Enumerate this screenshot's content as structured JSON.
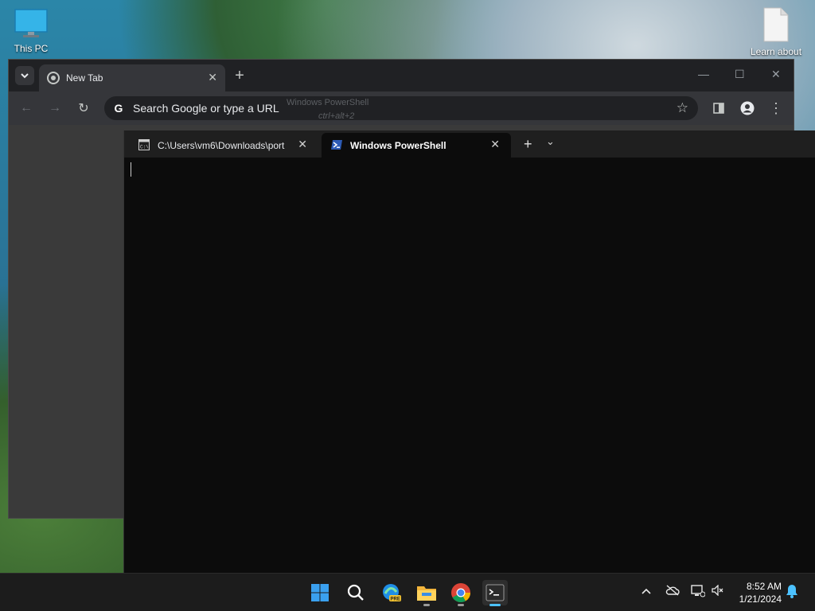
{
  "desktop": {
    "icons": [
      {
        "label": "This PC"
      },
      {
        "label": "Learn about"
      }
    ]
  },
  "chrome": {
    "tab": {
      "title": "New Tab"
    },
    "omnibox": {
      "placeholder": "Search Google or type a URL",
      "engine_glyph": "G"
    },
    "hint_overlay": {
      "title": "Windows PowerShell",
      "shortcut": "ctrl+alt+2"
    }
  },
  "terminal": {
    "tabs": [
      {
        "title": "C:\\Users\\vm6\\Downloads\\port",
        "active": false
      },
      {
        "title": "Windows PowerShell",
        "active": true
      }
    ],
    "new_tab_glyph": "+",
    "dropdown_glyph": "⌄"
  },
  "taskbar": {
    "clock": {
      "time": "8:52 AM",
      "date": "1/21/2024"
    },
    "edge_badge": "PRE"
  }
}
